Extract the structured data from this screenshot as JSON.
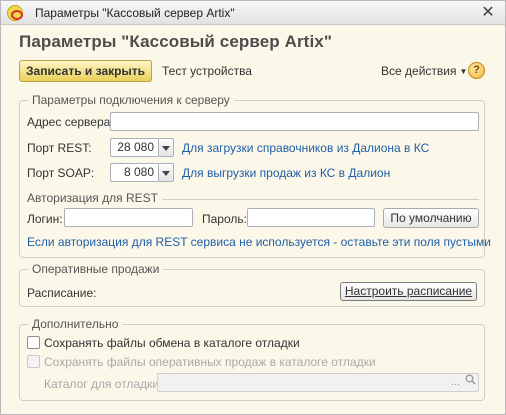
{
  "window": {
    "title": "Параметры \"Кассовый сервер Artix\"",
    "heading": "Параметры \"Кассовый сервер Artix\""
  },
  "toolbar": {
    "save_close": "Записать и закрыть",
    "test_device": "Тест устройства",
    "all_actions": "Все действия",
    "help": "?"
  },
  "connection": {
    "legend": "Параметры подключения к серверу",
    "server_address_label": "Адрес сервера:",
    "server_address_value": "",
    "rest_port_label": "Порт REST:",
    "rest_port_value": "28 080",
    "rest_port_hint": "Для загрузки справочников из Далиона в КС",
    "soap_port_label": "Порт SOAP:",
    "soap_port_value": "8 080",
    "soap_port_hint": "Для выгрузки продаж из КС в Далион",
    "auth": {
      "legend": "Авторизация для REST",
      "login_label": "Логин:",
      "login_value": "",
      "password_label": "Пароль:",
      "password_value": "",
      "default_button": "По умолчанию",
      "note": "Если авторизация для REST сервиса не используется - оставьте эти поля пустыми"
    }
  },
  "sales": {
    "legend": "Оперативные продажи",
    "schedule_label": "Расписание:",
    "schedule_button": "Настроить расписание"
  },
  "extra": {
    "legend": "Дополнительно",
    "save_exchange_files": "Сохранять файлы обмена в каталоге отладки",
    "save_exchange_files_checked": false,
    "save_sales_files": "Сохранять файлы оперативных продаж в каталоге отладки",
    "save_sales_files_checked": false,
    "debug_dir_label": "Каталог для отладки:",
    "debug_dir_value": "",
    "picker_dots": "...",
    "search_icon": "magnifier-icon"
  }
}
